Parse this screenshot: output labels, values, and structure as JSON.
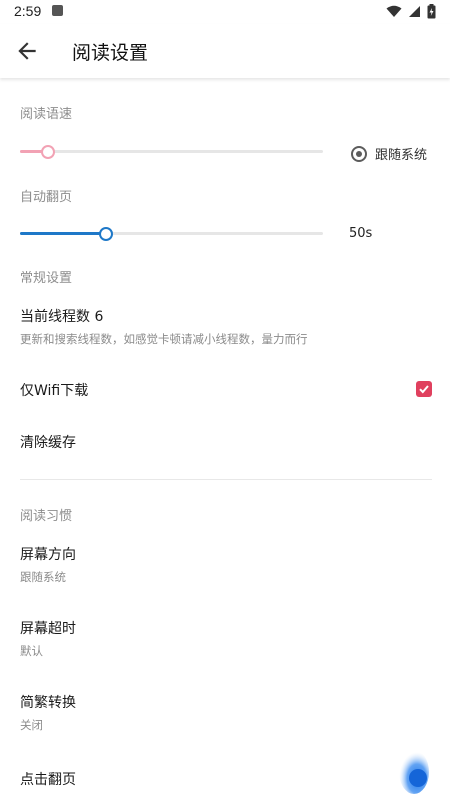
{
  "status_bar": {
    "time": "2:59"
  },
  "app_bar": {
    "title": "阅读设置",
    "back_icon": "arrow-back-icon"
  },
  "sections": {
    "read_aloud": {
      "header": "阅读语速",
      "speed_value_fraction": 0.09,
      "follow_system_label": "跟随系统",
      "follow_system_selected": true
    },
    "auto_page": {
      "header": "自动翻页",
      "value_fraction": 0.28,
      "value_label": "50s"
    },
    "general": {
      "header": "常规设置",
      "threads_title": "当前线程数 6",
      "threads_summary": "更新和搜索线程数，如感觉卡顿请减小线程数，量力而行",
      "wifi_only_title": "仅Wifi下载",
      "wifi_only_checked": true,
      "clear_cache_title": "清除缓存"
    },
    "habits": {
      "header": "阅读习惯",
      "items": [
        {
          "title": "屏幕方向",
          "summary": "跟随系统"
        },
        {
          "title": "屏幕超时",
          "summary": "默认"
        },
        {
          "title": "简繁转换",
          "summary": "关闭"
        },
        {
          "title": "点击翻页",
          "summary": ""
        }
      ]
    }
  },
  "colors": {
    "accent_blue": "#1e78c8",
    "accent_pink": "#f2a2b4",
    "checkbox_red": "#e0405e",
    "fab_blue": "#1a73e8"
  }
}
